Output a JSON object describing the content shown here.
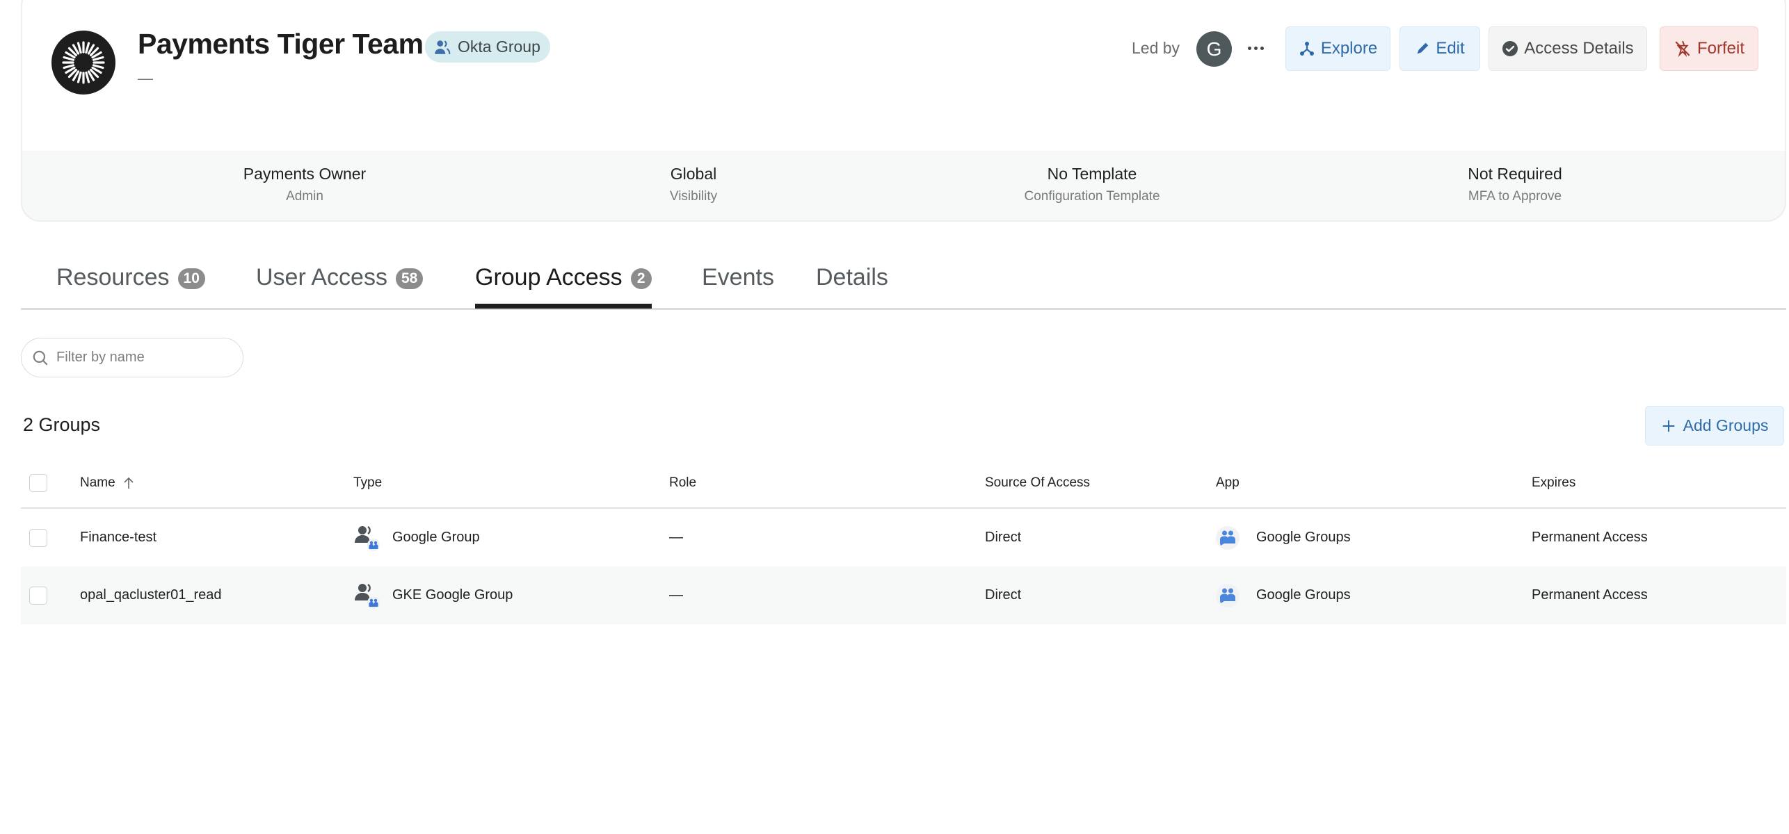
{
  "header": {
    "title": "Payments Tiger Team",
    "badge": {
      "label": "Okta Group",
      "icon": "users-icon"
    },
    "description": "—",
    "led_by_label": "Led by",
    "leader_avatar_initial": "G",
    "more_icon": "ellipsis-icon",
    "actions": [
      {
        "id": "explore",
        "label": "Explore",
        "icon": "graph-nodes-icon"
      },
      {
        "id": "edit",
        "label": "Edit",
        "icon": "pencil-icon"
      },
      {
        "id": "access_details",
        "label": "Access Details",
        "icon": "check-circle-icon"
      },
      {
        "id": "forfeit",
        "label": "Forfeit",
        "icon": "forfeit-icon"
      }
    ],
    "colors": {
      "accent": "#2f6aa8",
      "danger": "#a2372d",
      "badge_bg": "#d7ecee"
    }
  },
  "info": [
    {
      "value": "Payments Owner",
      "label": "Admin"
    },
    {
      "value": "Global",
      "label": "Visibility"
    },
    {
      "value": "No Template",
      "label": "Configuration Template"
    },
    {
      "value": "Not Required",
      "label": "MFA to Approve"
    }
  ],
  "tabs": [
    {
      "label": "Resources",
      "count": "10",
      "active": false
    },
    {
      "label": "User Access",
      "count": "58",
      "active": false
    },
    {
      "label": "Group Access",
      "count": "2",
      "active": true
    },
    {
      "label": "Events",
      "count": null,
      "active": false
    },
    {
      "label": "Details",
      "count": null,
      "active": false
    }
  ],
  "filter": {
    "placeholder": "Filter by name",
    "value": ""
  },
  "groups_count": "2 Groups",
  "add_groups_label": "Add Groups",
  "table": {
    "columns": [
      "Name",
      "Type",
      "Role",
      "Source Of Access",
      "App",
      "Expires"
    ],
    "sort": {
      "column": "Name",
      "direction": "ascending"
    },
    "rows": [
      {
        "name": "Finance-test",
        "type": "Google Group",
        "role": "—",
        "source": "Direct",
        "app": "Google Groups",
        "expires": "Permanent Access"
      },
      {
        "name": "opal_qacluster01_read",
        "type": "GKE Google Group",
        "role": "—",
        "source": "Direct",
        "app": "Google Groups",
        "expires": "Permanent Access"
      }
    ]
  }
}
